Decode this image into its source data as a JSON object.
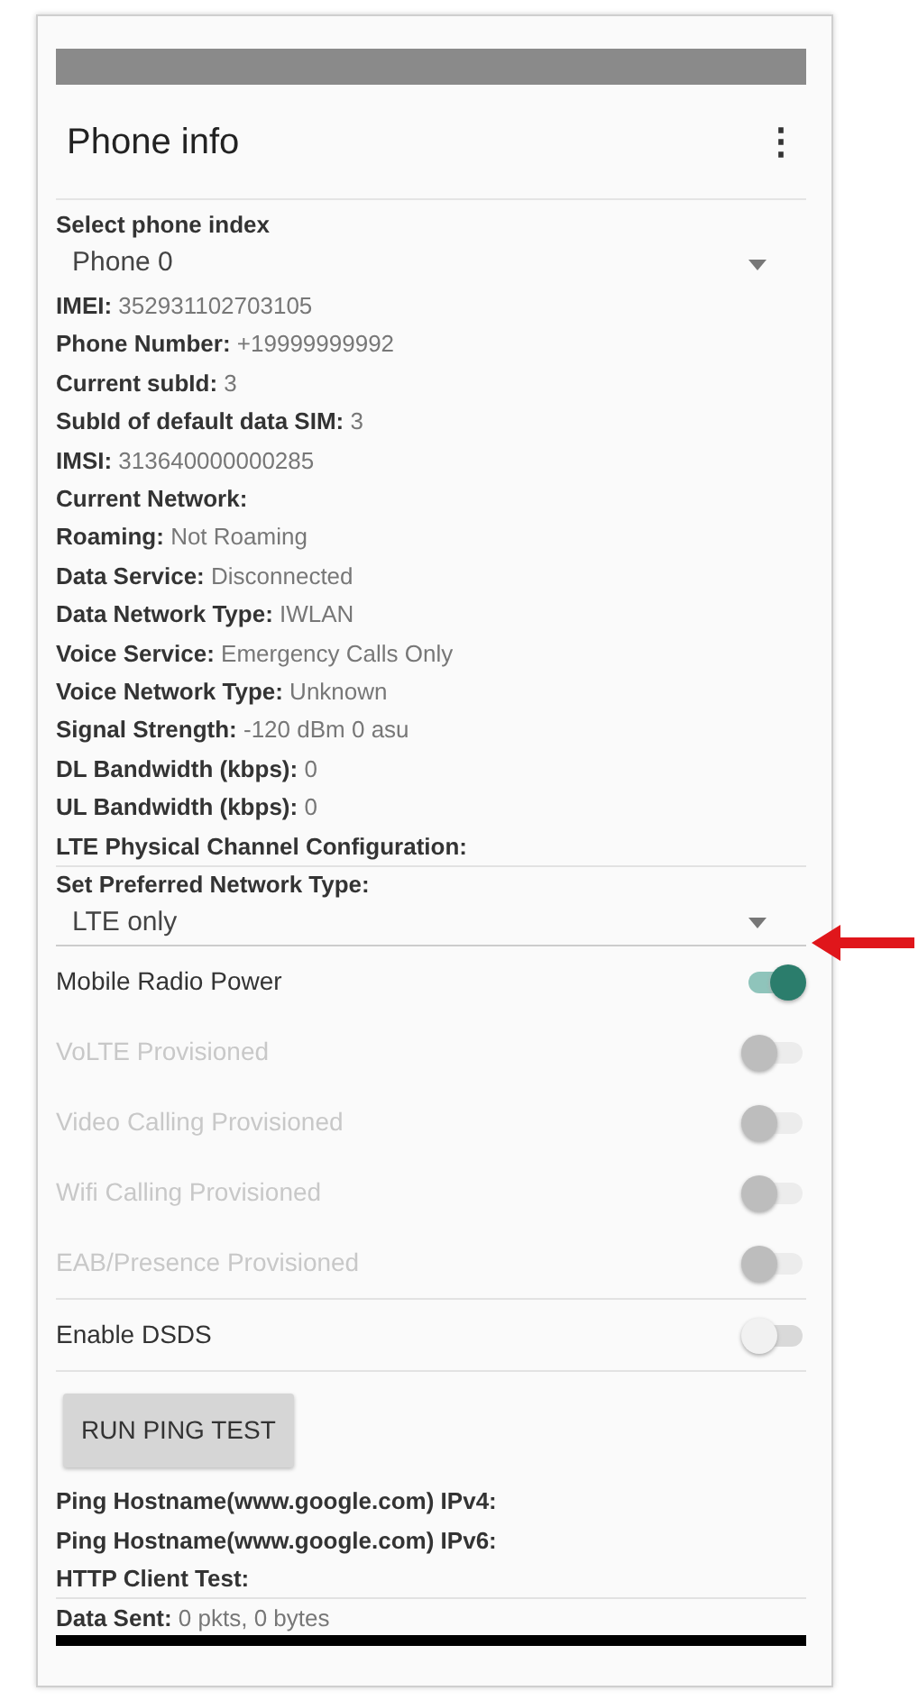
{
  "app_bar": {
    "title": "Phone info",
    "menu_icon": "⋮"
  },
  "phone_select": {
    "label": "Select phone index",
    "value": "Phone 0"
  },
  "info": [
    {
      "label": "IMEI:",
      "value": "352931102703105"
    },
    {
      "label": "Phone Number:",
      "value": "+19999999992"
    },
    {
      "label": "Current subId:",
      "value": "3"
    },
    {
      "label": "SubId of default data SIM:",
      "value": "3"
    },
    {
      "label": "IMSI:",
      "value": "313640000000285"
    },
    {
      "label": "Current Network:"
    },
    {
      "label": "Roaming:",
      "value": "Not Roaming"
    },
    {
      "label": "Data Service:",
      "value": "Disconnected"
    },
    {
      "label": "Data Network Type:",
      "value": "IWLAN"
    },
    {
      "label": "Voice Service:",
      "value": "Emergency Calls Only"
    },
    {
      "label": "Voice Network Type:",
      "value": "Unknown"
    },
    {
      "label": "Signal Strength:",
      "value": "-120 dBm   0 asu"
    },
    {
      "label": "DL Bandwidth (kbps):",
      "value": "0"
    },
    {
      "label": "UL Bandwidth (kbps):",
      "value": "0"
    },
    {
      "label": "LTE Physical Channel Configuration:"
    }
  ],
  "network_select": {
    "label": "Set Preferred Network Type:",
    "value": "LTE only"
  },
  "switches": [
    {
      "label": "Mobile Radio Power",
      "on": true,
      "disabled": false
    },
    {
      "label": "VoLTE Provisioned",
      "on": false,
      "disabled": true
    },
    {
      "label": "Video Calling Provisioned",
      "on": false,
      "disabled": true
    },
    {
      "label": "Wifi Calling Provisioned",
      "on": false,
      "disabled": true
    },
    {
      "label": "EAB/Presence Provisioned",
      "on": false,
      "disabled": true
    },
    {
      "label": "Enable DSDS",
      "on": false,
      "disabled": false
    }
  ],
  "ping_button": "RUN PING TEST",
  "ping_results": [
    {
      "label": "Ping Hostname(www.google.com) IPv4:"
    },
    {
      "label": "Ping Hostname(www.google.com) IPv6:"
    },
    {
      "label": "HTTP Client Test:"
    }
  ],
  "data_sent": {
    "label": "Data Sent:",
    "value": "0 pkts, 0 bytes"
  }
}
